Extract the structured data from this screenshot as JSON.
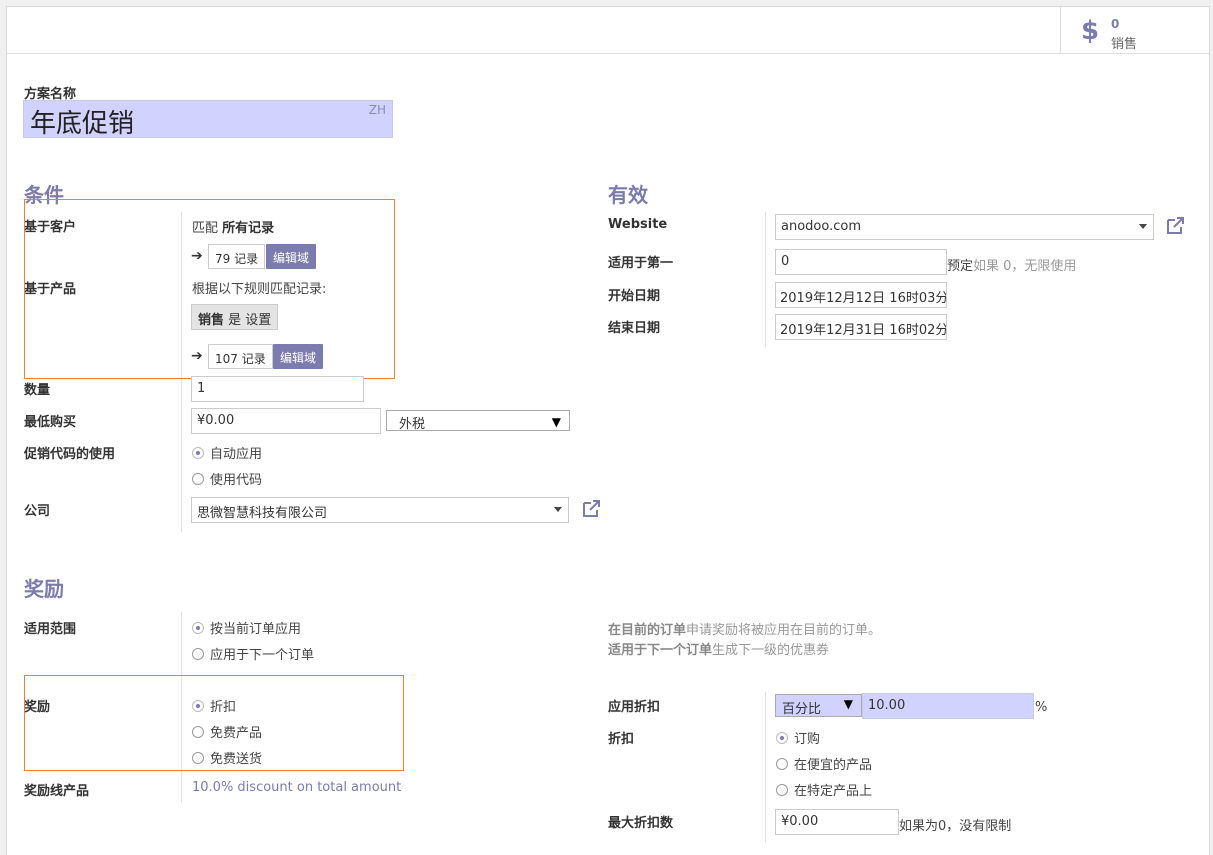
{
  "smart_button": {
    "count": "0",
    "label": "销售"
  },
  "program": {
    "name_label": "方案名称",
    "name_value": "年底促销",
    "lang": "ZH"
  },
  "conditions": {
    "title": "条件",
    "customer_label": "基于客户",
    "customer_match_prefix": "匹配",
    "customer_match_bold": "所有记录",
    "customer_records": "79 记录",
    "edit_domain": "编辑域",
    "product_label": "基于产品",
    "product_rule_text": "根据以下规则匹配记录:",
    "product_tag_bold": "销售",
    "product_tag_rest": "是 设置",
    "product_records": "107 记录",
    "quantity_label": "数量",
    "quantity_value": "1",
    "min_purchase_label": "最低购买",
    "min_purchase_value": "¥0.00",
    "tax_value": "外税",
    "promo_usage_label": "促销代码的使用",
    "promo_options": [
      "自动应用",
      "使用代码"
    ],
    "company_label": "公司",
    "company_value": "思微智慧科技有限公司"
  },
  "validity": {
    "title": "有效",
    "website_label": "Website",
    "website_value": "anodoo.com",
    "first_label": "适用于第一",
    "first_value": "0",
    "first_suffix": "预定",
    "first_hint": "如果 0，无限使用",
    "start_label": "开始日期",
    "start_value": "2019年12月12日 16时03分",
    "end_label": "结束日期",
    "end_value": "2019年12月31日 16时02分"
  },
  "reward": {
    "title": "奖励",
    "scope_label": "适用范围",
    "scope_options": [
      "按当前订单应用",
      "应用于下一个订单"
    ],
    "scope_help_1_bold": "在目前的订单",
    "scope_help_1_rest": "申请奖励将被应用在目前的订单。",
    "scope_help_2_bold": "适用于下一个订单",
    "scope_help_2_rest": "生成下一级的优惠券",
    "reward_label": "奖励",
    "reward_options": [
      "折扣",
      "免费产品",
      "免费送货"
    ],
    "line_product_label": "奖励线产品",
    "line_product_value": "10.0% discount on total amount",
    "apply_discount_label": "应用折扣",
    "discount_type": "百分比",
    "discount_value": "10.00",
    "percent_sign": "%",
    "discount_label": "折扣",
    "discount_options": [
      "订购",
      "在便宜的产品",
      "在特定产品上"
    ],
    "max_discount_label": "最大折扣数",
    "max_discount_value": "¥0.00",
    "max_discount_hint": "如果为0，没有限制"
  }
}
